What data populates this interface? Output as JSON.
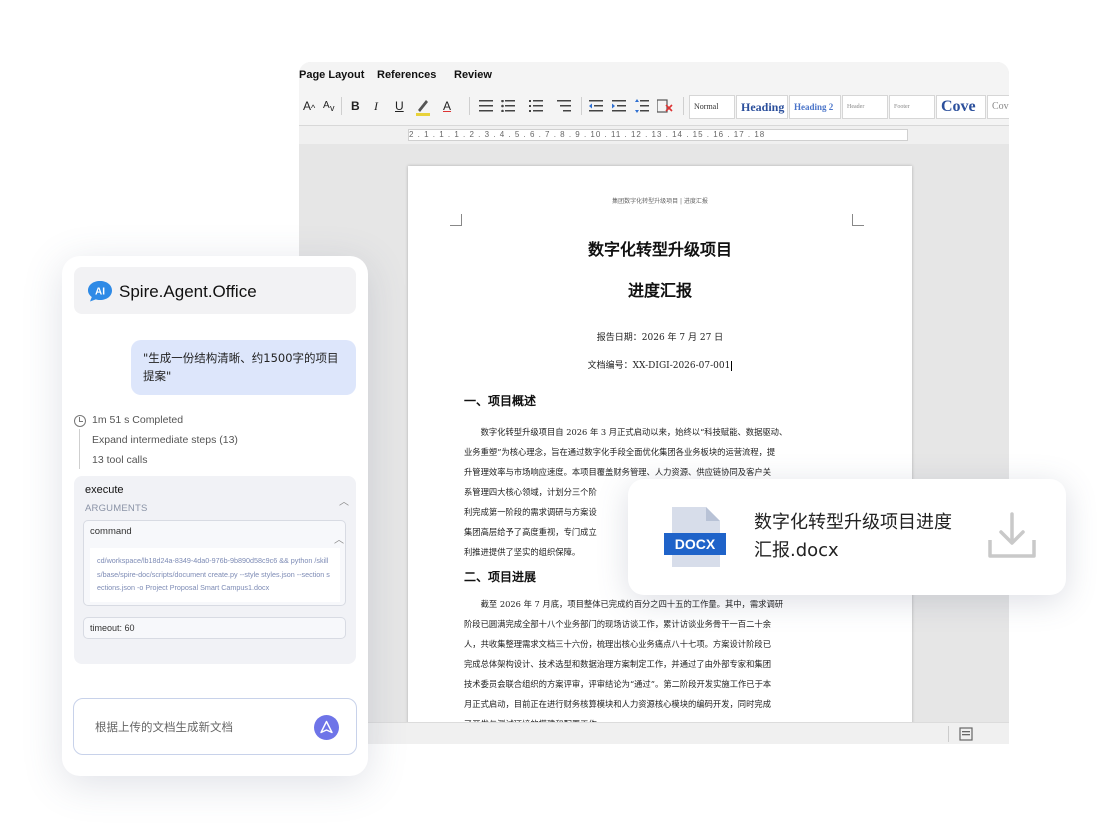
{
  "word": {
    "tabs": [
      "Page Layout",
      "References",
      "Review"
    ],
    "toolbar": {
      "grow_font": "A",
      "shrink_font": "A",
      "bold": "B",
      "italic": "I",
      "underline": "U",
      "font_color": "A",
      "styles": [
        "Normal",
        "Heading",
        "Heading 2",
        "Header",
        "Footer",
        "Cove",
        "Cov"
      ]
    },
    "ruler_text": "2 . 1 . 1 . 1 . 2 . 3 . 4 . 5 . 6 . 7 . 8 . 9 . 10 . 11 . 12 . 13 . 14 . 15 . 16 . 17 . 18"
  },
  "document": {
    "running_header": "集团数字化转型升级项目 | 进度汇报",
    "title_line1": "数字化转型升级项目",
    "title_line2": "进度汇报",
    "report_date": "报告日期：2026 年 7 月 27 日",
    "doc_number": "文档编号：XX-DIGI-2026-07-001",
    "section1_heading": "一、项目概述",
    "section1_lines": [
      "数字化转型升级项目自 2026 年 3 月正式启动以来，始终以“科技赋能、数据驱动、",
      "业务重塑”为核心理念，旨在通过数字化手段全面优化集团各业务板块的运营流程，提",
      "升管理效率与市场响应速度。本项目覆盖财务管理、人力资源、供应链协同及客户关",
      "系管理四大核心领域，计划分三个阶",
      "利完成第一阶段的需求调研与方案设",
      "集团高层给予了高度重视，专门成立",
      "利推进提供了坚实的组织保障。"
    ],
    "section2_heading": "二、项目进展",
    "section2_lines": [
      "截至 2026 年 7 月底，项目整体已完成约百分之四十五的工作量。其中，需求调研",
      "阶段已圆满完成全部十八个业务部门的现场访谈工作，累计访谈业务骨干一百二十余",
      "人，共收集整理需求文档三十六份，梳理出核心业务痛点八十七项。方案设计阶段已",
      "完成总体架构设计、技术选型和数据治理方案制定工作，并通过了由外部专家和集团",
      "技术委员会联合组织的方案评审，评审结论为“通过”。第二阶段开发实施工作已于本",
      "月正式启动，目前正在进行财务核算模块和人力资源核心模块的编码开发，同时完成",
      "了开发与测试环境的搭建和配置工作。"
    ]
  },
  "agent": {
    "icon_text": "AI",
    "title": "Spire.Agent.Office",
    "user_message": "\"生成一份结构清晰、约1500字的项目提案\"",
    "steps": {
      "completed": "1m 51 s Completed",
      "expand": "Expand intermediate steps (13)",
      "tool_calls": "13 tool calls"
    },
    "execute": {
      "name": "execute",
      "arguments_label": "ARGUMENTS",
      "command_label": "command",
      "command_text": "cd/workspace/lb18d24a-8349-4da0-976b-9b890d58c9c6 && python /skills/base/spire-doc/scripts/document create.py --style styles.json --section sections.json -o Project Proposal Smart Campus1.docx",
      "timeout": "timeout: 60"
    },
    "input_placeholder": "根据上传的文档生成新文档"
  },
  "file_card": {
    "badge": "DOCX",
    "file_name": "数字化转型升级项目进度汇报.docx",
    "icon_color": "#1f63c9"
  },
  "colors": {
    "accent": "#6e74e8",
    "bubble": "#dde6fb",
    "ai_icon": "#2e8ae6"
  }
}
